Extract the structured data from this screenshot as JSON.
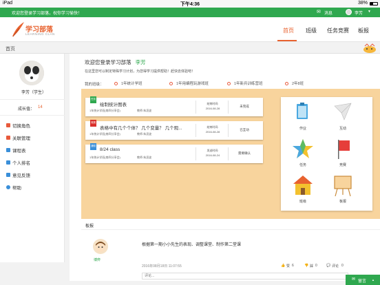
{
  "status_bar": {
    "device": "iPad",
    "time": "下午4:36",
    "battery": "38%"
  },
  "top_bar": {
    "welcome": "欢迎您登录学习部落，祝你学习愉快！",
    "messages": "消息",
    "user": "李芳"
  },
  "logo": {
    "name": "学习部落",
    "subtitle": "LEARNING CLAN"
  },
  "nav": {
    "items": [
      "首页",
      "班级",
      "任务竞赛",
      "板报"
    ],
    "active": "首页"
  },
  "breadcrumb": {
    "label": "首页"
  },
  "profile": {
    "name": "李芳（学生）",
    "growth_label": "成长值：",
    "growth_value": "14"
  },
  "sidebar_menu": [
    {
      "label": "切换角色",
      "icon": "switch-icon",
      "color": "#e85a3c"
    },
    {
      "label": "关联管理",
      "icon": "link-icon",
      "color": "#e85a3c"
    },
    {
      "label": "课程表",
      "icon": "calendar-icon",
      "color": "#3a8fd9"
    },
    {
      "label": "个人排名",
      "icon": "ranking-icon",
      "color": "#3a8fd9"
    },
    {
      "label": "意见反馈",
      "icon": "feedback-icon",
      "color": "#3a8fd9"
    },
    {
      "label": "帮助",
      "icon": "help-icon",
      "color": "#3a8fd9"
    }
  ],
  "welcome": {
    "greeting": "欢迎您登录学习部落",
    "name": "李芳",
    "hint": "在这里您可以制定特殊学习计划，为您得学习提供帮助！赶快去体验吧！"
  },
  "classes": {
    "label": "我的班级：",
    "items": [
      "1年统计学班",
      "1年用编程玩游戏班",
      "1年新兵训练营班",
      "2年8班"
    ]
  },
  "tasks": [
    {
      "tag": "任务",
      "tag_color": "#2fa84f",
      "title": "绘制统计图表",
      "class": "1年统计学班(南四分享会)",
      "teacher": "教师:朱凌波",
      "time_label": "结束时间:",
      "time": "2016-08-28",
      "action": "未完成"
    },
    {
      "tag": "竞赛",
      "tag_color": "#d9302c",
      "title": "表格中有几个个体？ 几个变量？ 几个观...",
      "class": "1年统计学班(南四分享会)",
      "teacher": "教师:朱凌波",
      "time_label": "结束时间:",
      "time": "2016-08-28",
      "action": "已互动"
    },
    {
      "tag": "通知",
      "tag_color": "#3a8fd9",
      "title": "8/24 class",
      "class": "1年统计学班(南四分享会)",
      "teacher": "教师:朱凌波",
      "time_label": "发送时间:",
      "time": "2016-08-24",
      "action": "需要确认"
    }
  ],
  "quick_icons": [
    {
      "label": "作业",
      "icon": "homework-icon"
    },
    {
      "label": "互动",
      "icon": "paper-plane-icon"
    },
    {
      "label": "任务",
      "icon": "star-icon"
    },
    {
      "label": "竞赛",
      "icon": "flag-icon"
    },
    {
      "label": "班级",
      "icon": "house-icon"
    },
    {
      "label": "板报",
      "icon": "easel-icon"
    }
  ],
  "board": {
    "title": "板报",
    "author": "博弈",
    "content": "根据第一期小小先生的表现、调整课堂、制作第二堂课",
    "timestamp": "2016年08月18日 11:07:55",
    "likes_label": "赞",
    "likes": "6",
    "dislikes_label": "踩",
    "dislikes": "0",
    "comments_label": "评论",
    "comments": "0",
    "comment_placeholder": "评论..."
  },
  "footer": {
    "message_button": "留言"
  },
  "colors": {
    "green": "#2fa84f",
    "orange": "#e8622f",
    "panel": "#f8d49d"
  }
}
